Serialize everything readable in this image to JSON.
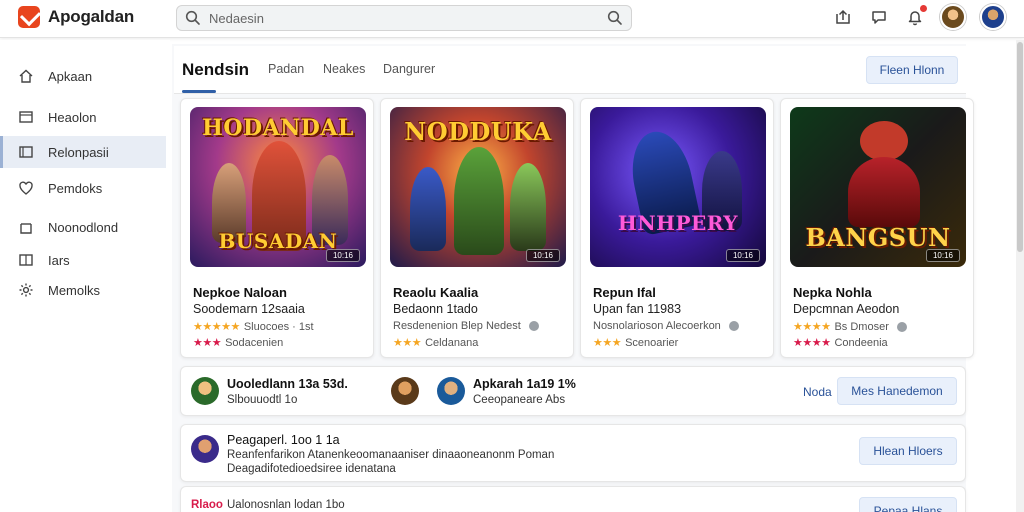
{
  "app": {
    "name": "Apogaldan",
    "brand_color": "#e8451e"
  },
  "search": {
    "placeholder": "Nedaesin"
  },
  "sidebar": {
    "items": [
      {
        "label": "Apkaan",
        "icon": "home-icon"
      },
      {
        "label": "Heaolon",
        "icon": "library-icon"
      },
      {
        "label": "Relonpasii",
        "icon": "recent-icon",
        "active": true
      },
      {
        "label": "Pemdoks",
        "icon": "heart-icon"
      },
      {
        "label": "Noonodlond",
        "icon": "download-icon"
      },
      {
        "label": "Iars",
        "icon": "tags-icon"
      },
      {
        "label": "Memolks",
        "icon": "settings-icon"
      }
    ]
  },
  "tabs": {
    "active": "Nendsin",
    "items": [
      "Padan",
      "Neakes",
      "Dangurer"
    ],
    "button": "Fleen Hlonn"
  },
  "cards": [
    {
      "cover_title": "HODANDAL",
      "cover_title2": "BUSADAN",
      "cover_badge": "10:16",
      "title": "Nepkoe Naloan",
      "subtitle": "Soodemarn 12saaia",
      "rating_text": "Sluocoes · 1st",
      "rating2_text": "Sodacenien",
      "stars": "★★★★★",
      "stars2": "★★★",
      "accent": "#ffcc33"
    },
    {
      "cover_title": "NODDUKA",
      "cover_title2": "",
      "cover_badge": "10:16",
      "title": "Reaolu Kaalia",
      "subtitle": "Bedaonn 1tado",
      "rating_text": "Resdenenion Blep Nedest",
      "rating2_text": "Celdanana",
      "stars": "",
      "stars2": "★★★",
      "accent": "#ffcc33"
    },
    {
      "cover_title": "HNHPERY",
      "cover_title2": "",
      "cover_badge": "10:16",
      "title": "Repun Ifal",
      "subtitle": "Upan fan 11983",
      "rating_text": "Nosnolarioson Alecoerkon",
      "rating2_text": "Scenoarier",
      "stars": "",
      "stars2": "★★★",
      "accent": "#ff4fd8"
    },
    {
      "cover_title": "BANGSUN",
      "cover_title2": "",
      "cover_badge": "10:16",
      "title": "Nepka Nohla",
      "subtitle": "Depcmnan Aeodon",
      "rating_text": "Bs Dmoser",
      "rating2_text": "Condeenia",
      "stars": "★★★★",
      "stars2": "★★★★",
      "accent": "#ffcc33"
    }
  ],
  "feed": {
    "row1": {
      "user1": "Uooledlann 13a 53d.",
      "user1_sub": "Slbouuodtl 1o",
      "user2": "Apkarah 1a19 1%",
      "user2_sub": "Ceeopaneare Abs",
      "link": "Noda",
      "button": "Mes Hanedemon"
    },
    "row2": {
      "title": "Peagaperl. 1oo 1 1a",
      "line1": "Reanfenfarikon Atanenkeoomanaaniser dinaaoneanonm Poman",
      "line2": "Deagadifotedioedsiree idenatana",
      "button": "Hlean Hloers"
    },
    "row3": {
      "tag": "Rlaoo",
      "text": "Ualonosnlan lodan 1bo",
      "button": "Pepaa Hlans"
    }
  }
}
